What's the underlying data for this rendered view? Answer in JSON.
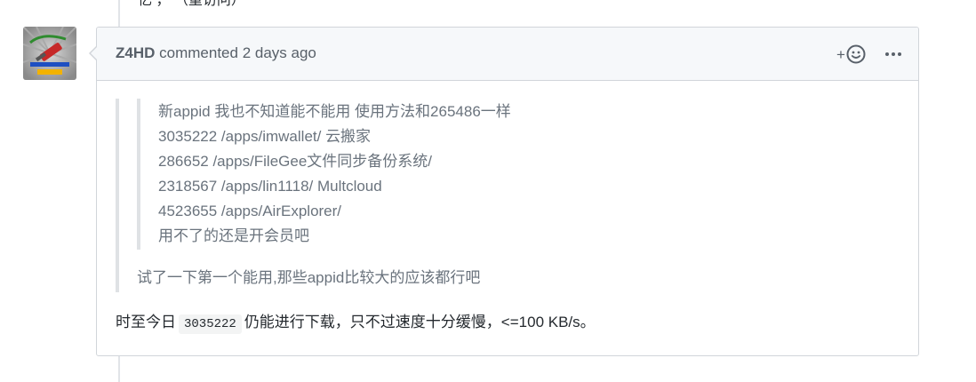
{
  "previous_comment": {
    "partial_text": "忆                              ，             （重访问）"
  },
  "comment": {
    "author": "Z4HD",
    "action_text": "commented",
    "time": "2 days ago",
    "reaction_plus": "+",
    "reaction_icon": "smiley-icon",
    "more_icon": "kebab-horizontal-icon",
    "nested_quote_lines": [
      "新appid 我也不知道能不能用 使用方法和265486一样",
      "3035222 /apps/imwallet/ 云搬家",
      "286652 /apps/FileGee文件同步备份系统/",
      "2318567 /apps/lin1118/ Multcloud",
      "4523655 /apps/AirExplorer/",
      "用不了的还是开会员吧"
    ],
    "quote_text": "试了一下第一个能用,那些appid比较大的应该都行吧",
    "final_paragraph": {
      "before": "时至今日",
      "code": "3035222",
      "after": "仍能进行下载，只不过速度十分缓慢，<=100 KB/s。"
    }
  },
  "colors": {
    "border": "#d1d5da",
    "header_bg": "#f6f8fa",
    "quote_text": "#6a737d",
    "body_text": "#24292e",
    "muted": "#586069"
  }
}
